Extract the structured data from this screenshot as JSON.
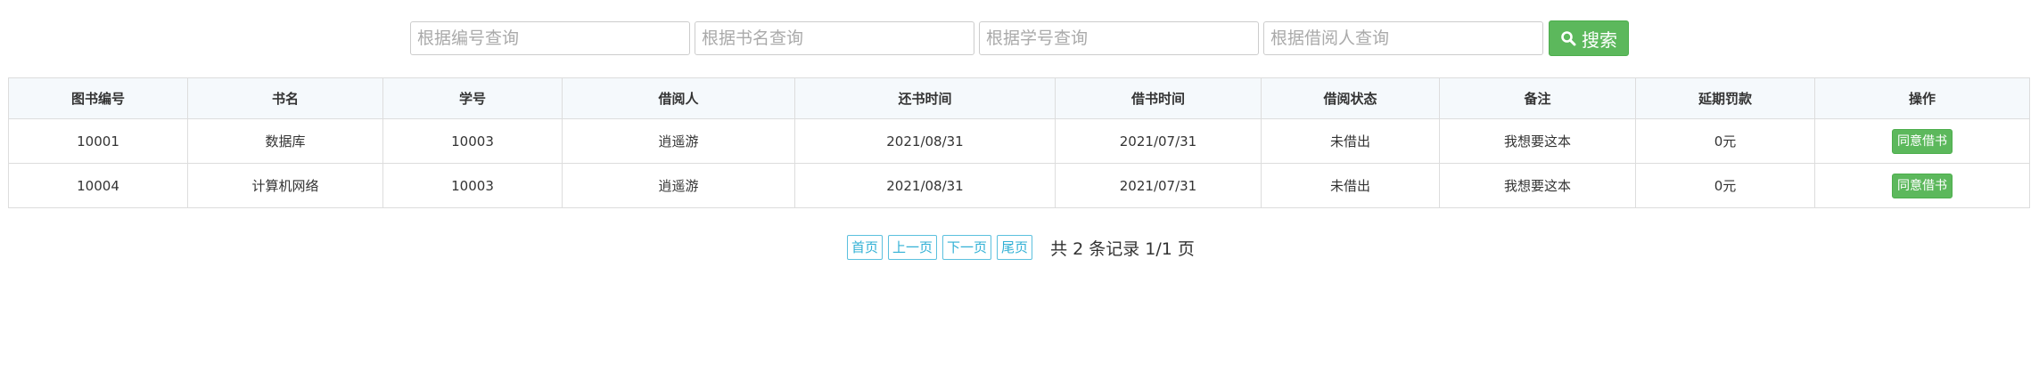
{
  "search": {
    "id_placeholder": "根据编号查询",
    "name_placeholder": "根据书名查询",
    "student_placeholder": "根据学号查询",
    "borrower_placeholder": "根据借阅人查询",
    "button_label": "搜索"
  },
  "table": {
    "headers": [
      "图书编号",
      "书名",
      "学号",
      "借阅人",
      "还书时间",
      "借书时间",
      "借阅状态",
      "备注",
      "延期罚款",
      "操作"
    ],
    "rows": [
      {
        "book_id": "10001",
        "book_name": "数据库",
        "student_id": "10003",
        "borrower": "逍遥游",
        "return_time": "2021/08/31",
        "borrow_time": "2021/07/31",
        "status": "未借出",
        "remark": "我想要这本",
        "fine": "0元",
        "action_label": "同意借书"
      },
      {
        "book_id": "10004",
        "book_name": "计算机网络",
        "student_id": "10003",
        "borrower": "逍遥游",
        "return_time": "2021/08/31",
        "borrow_time": "2021/07/31",
        "status": "未借出",
        "remark": "我想要这本",
        "fine": "0元",
        "action_label": "同意借书"
      }
    ]
  },
  "pagination": {
    "first": "首页",
    "prev": "上一页",
    "next": "下一页",
    "last": "尾页",
    "summary": "共 2 条记录 1/1 页"
  },
  "colors": {
    "success": "#5cb85c",
    "info": "#5bc0de",
    "header_bg": "#f5f9fc",
    "border": "#dddddd"
  }
}
